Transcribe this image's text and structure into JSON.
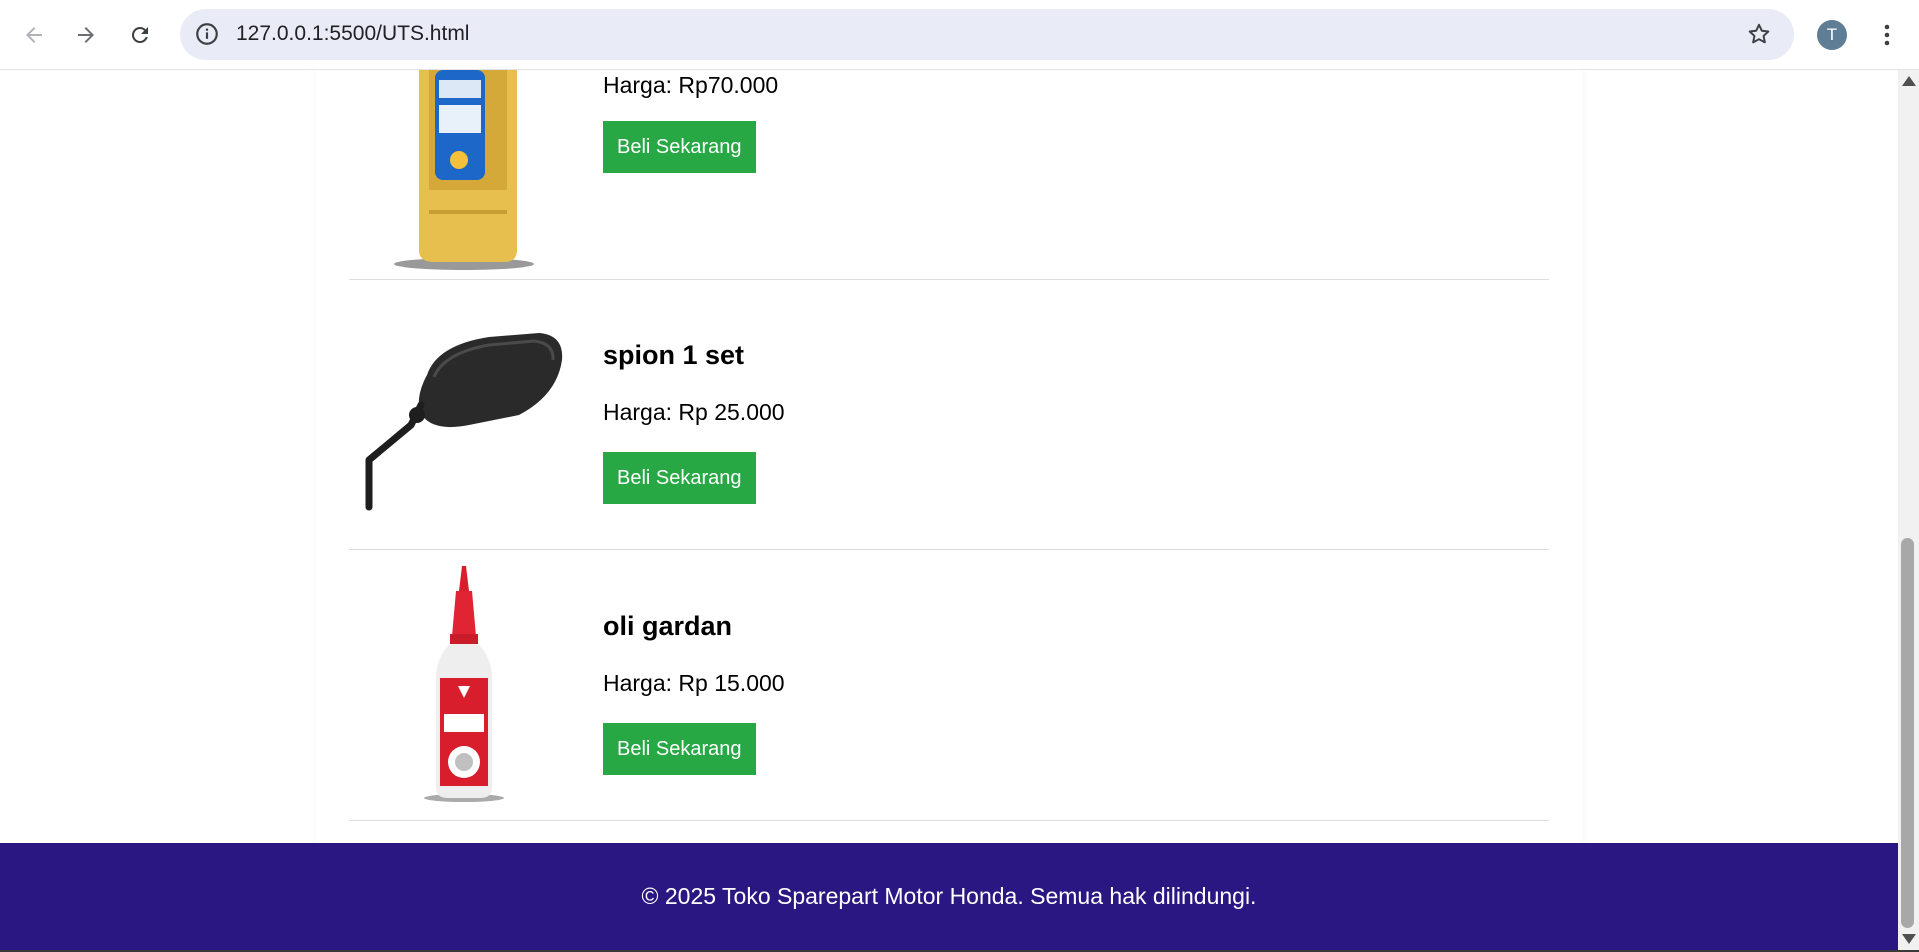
{
  "browser": {
    "url": "127.0.0.1:5500/UTS.html",
    "profile_initial": "T",
    "icons": {
      "back": "arrow-left-icon",
      "forward": "arrow-right-icon",
      "reload": "reload-icon",
      "site_info": "info-icon",
      "bookmark": "star-icon",
      "menu": "kebab-menu-icon"
    }
  },
  "products": [
    {
      "name": "",
      "price": "Harga: Rp70.000",
      "button": "Beli Sekarang",
      "image": "engine-oil-bottle"
    },
    {
      "name": "spion 1 set",
      "price": "Harga: Rp 25.000",
      "button": "Beli Sekarang",
      "image": "motorcycle-mirror"
    },
    {
      "name": "oli gardan",
      "price": "Harga: Rp 15.000",
      "button": "Beli Sekarang",
      "image": "gear-oil-bottle"
    }
  ],
  "footer": {
    "text": "© 2025 Toko Sparepart Motor Honda. Semua hak dilindungi."
  },
  "colors": {
    "button": "#28a745",
    "footer_bg": "#2b1782",
    "divider": "#dddddd"
  }
}
